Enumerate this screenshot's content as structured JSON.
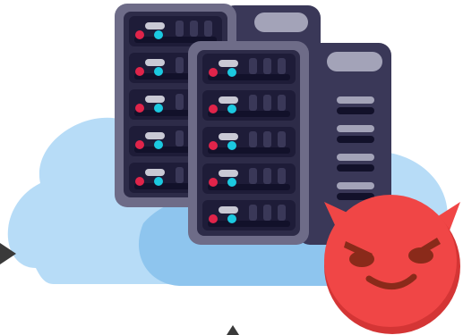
{
  "illustration": {
    "type": "server-rack-cloud-devil",
    "icons": {
      "cloud": "cloud-icon",
      "server_back": "server-rack-icon",
      "server_front": "server-rack-icon",
      "devil": "devil-emoji-icon",
      "arrow_left": "triangle-right-icon",
      "arrow_bottom": "triangle-up-icon"
    },
    "colors": {
      "cloud_light": "#b7dcf7",
      "cloud_dark": "#8ec5ee",
      "rack_frame": "#6e6c88",
      "rack_body": "#2d2b48",
      "rack_side": "#3a3858",
      "unit": "#1e1c38",
      "unit_bar": "#12112a",
      "led_red": "#e0244a",
      "led_cyan": "#1bc9e0",
      "label_gray": "#c9c9d4",
      "slot_light": "#a3a3b8",
      "devil_face": "#f04646",
      "devil_shade": "#d43535",
      "devil_features": "#8a2a1a",
      "arrow": "#3a3a3a"
    },
    "server_units_per_rack": 5
  }
}
